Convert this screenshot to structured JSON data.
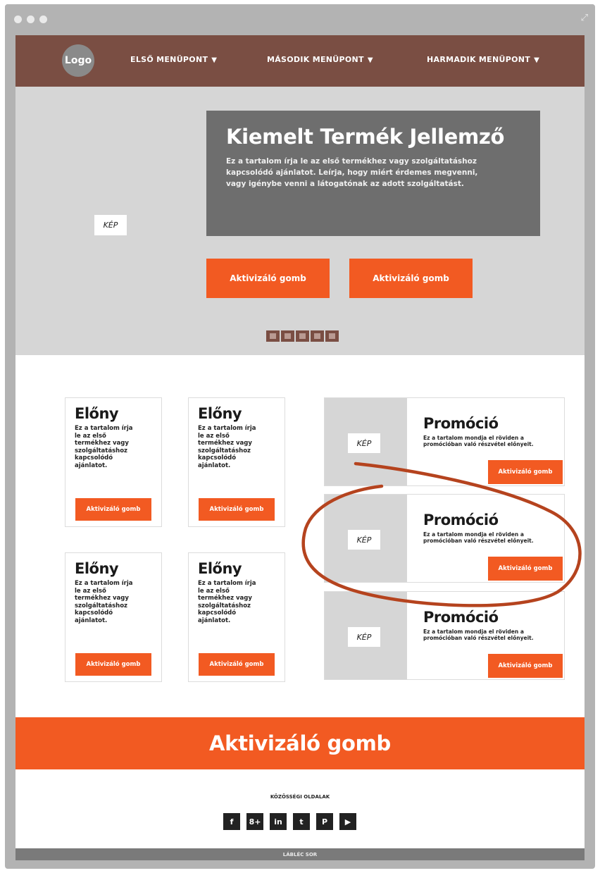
{
  "nav": {
    "logo": "Logo",
    "items": [
      {
        "label": "ELSŐ MENÜPONT",
        "caret": "▼"
      },
      {
        "label": "MÁSODIK MENÜPONT",
        "caret": "▼"
      },
      {
        "label": "HARMADIK MENÜPONT",
        "caret": "▼"
      }
    ]
  },
  "hero": {
    "image_label": "KÉP",
    "title": "Kiemelt Termék Jellemző",
    "text": "Ez a tartalom írja le az első termékhez vagy szolgáltatáshoz kapcsolódó ajánlatot. Leírja, hogy miért érdemes megvenni, vagy igénybe venni a látogatónak az adott szolgáltatást.",
    "button1": "Aktivizáló gomb",
    "button2": "Aktivizáló gomb",
    "slides": 5
  },
  "cards": [
    {
      "title": "Előny",
      "text": "Ez a tartalom írja le az első termékhez vagy szolgáltatáshoz kapcsolódó ajánlatot.",
      "button": "Aktivizáló gomb"
    },
    {
      "title": "Előny",
      "text": "Ez a tartalom írja le az első termékhez vagy szolgáltatáshoz kapcsolódó ajánlatot.",
      "button": "Aktivizáló gomb"
    },
    {
      "title": "Előny",
      "text": "Ez a tartalom írja le az első termékhez vagy szolgáltatáshoz kapcsolódó ajánlatot.",
      "button": "Aktivizáló gomb"
    },
    {
      "title": "Előny",
      "text": "Ez a tartalom írja le az első termékhez vagy szolgáltatáshoz kapcsolódó ajánlatot.",
      "button": "Aktivizáló gomb"
    }
  ],
  "promos": [
    {
      "image_label": "KÉP",
      "title": "Promóció",
      "text": "Ez a tartalom mondja el röviden a promócióban való részvétel előnyeit.",
      "button": "Aktivizáló gomb"
    },
    {
      "image_label": "KÉP",
      "title": "Promóció",
      "text": "Ez a tartalom mondja el röviden a promócióban való részvétel előnyeit.",
      "button": "Aktivizáló gomb"
    },
    {
      "image_label": "KÉP",
      "title": "Promóció",
      "text": "Ez a tartalom mondja el röviden a promócióban való részvétel előnyeit.",
      "button": "Aktivizáló gomb"
    }
  ],
  "big_cta": "Aktivizáló gomb",
  "footer": {
    "label": "KÖZÖSSÉGI OLDALAK",
    "social": [
      "f",
      "8+",
      "in",
      "t",
      "P",
      "▶"
    ],
    "bottom": "LÁBLÉC SOR"
  },
  "colors": {
    "accent": "#f25a22",
    "nav": "#7a4e43",
    "hero_bg": "#d6d6d6",
    "feature_bg": "#6e6e6e",
    "annotation": "#b5431e"
  },
  "icons": {
    "window_dots": "traffic-light-icon",
    "resize": "expand-icon"
  }
}
